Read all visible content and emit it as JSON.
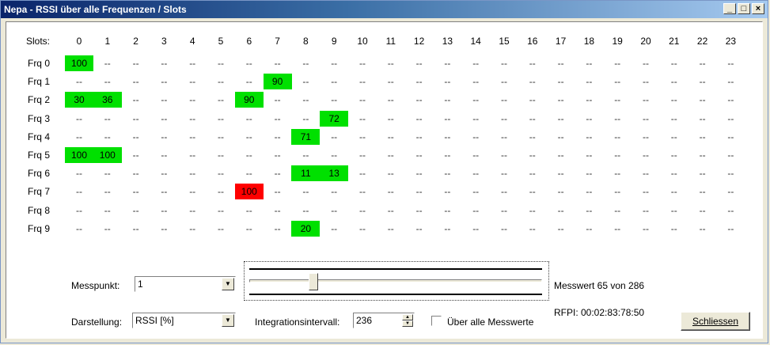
{
  "window": {
    "title": "Nepa - RSSI über alle Frequenzen / Slots"
  },
  "grid": {
    "slots_label": "Slots:",
    "slots": [
      "0",
      "1",
      "2",
      "3",
      "4",
      "5",
      "6",
      "7",
      "8",
      "9",
      "10",
      "11",
      "12",
      "13",
      "14",
      "15",
      "16",
      "17",
      "18",
      "19",
      "20",
      "21",
      "22",
      "23"
    ],
    "empty_value": "--",
    "rows": [
      {
        "label": "Frq 0",
        "cells": [
          {
            "slot": 0,
            "value": "100",
            "status": "green"
          }
        ]
      },
      {
        "label": "Frq 1",
        "cells": [
          {
            "slot": 7,
            "value": "90",
            "status": "green"
          }
        ]
      },
      {
        "label": "Frq 2",
        "cells": [
          {
            "slot": 0,
            "value": "30",
            "status": "green"
          },
          {
            "slot": 1,
            "value": "36",
            "status": "green"
          },
          {
            "slot": 6,
            "value": "90",
            "status": "green"
          }
        ]
      },
      {
        "label": "Frq 3",
        "cells": [
          {
            "slot": 9,
            "value": "72",
            "status": "green"
          }
        ]
      },
      {
        "label": "Frq 4",
        "cells": [
          {
            "slot": 8,
            "value": "71",
            "status": "green"
          }
        ]
      },
      {
        "label": "Frq 5",
        "cells": [
          {
            "slot": 0,
            "value": "100",
            "status": "green"
          },
          {
            "slot": 1,
            "value": "100",
            "status": "green"
          }
        ]
      },
      {
        "label": "Frq 6",
        "cells": [
          {
            "slot": 8,
            "value": "11",
            "status": "green"
          },
          {
            "slot": 9,
            "value": "13",
            "status": "green"
          }
        ]
      },
      {
        "label": "Frq 7",
        "cells": [
          {
            "slot": 6,
            "value": "100",
            "status": "red"
          }
        ]
      },
      {
        "label": "Frq 8",
        "cells": []
      },
      {
        "label": "Frq 9",
        "cells": [
          {
            "slot": 8,
            "value": "20",
            "status": "green"
          }
        ]
      }
    ]
  },
  "controls": {
    "messpunkt_label": "Messpunkt:",
    "messpunkt_value": "1",
    "darstellung_label": "Darstellung:",
    "darstellung_value": "RSSI  [%]",
    "integration_label": "Integrationsintervall:",
    "integration_value": "236",
    "checkbox_label": "Über alle Messwerte",
    "checkbox_checked": false,
    "messwert_text": "Messwert 65 von 286",
    "rfpi_text": "RFPI: 00:02:83:78:50",
    "close_button": "Schliessen",
    "slider_position": 0.22
  },
  "colors": {
    "green": "#00e000",
    "red": "#ff0000"
  }
}
